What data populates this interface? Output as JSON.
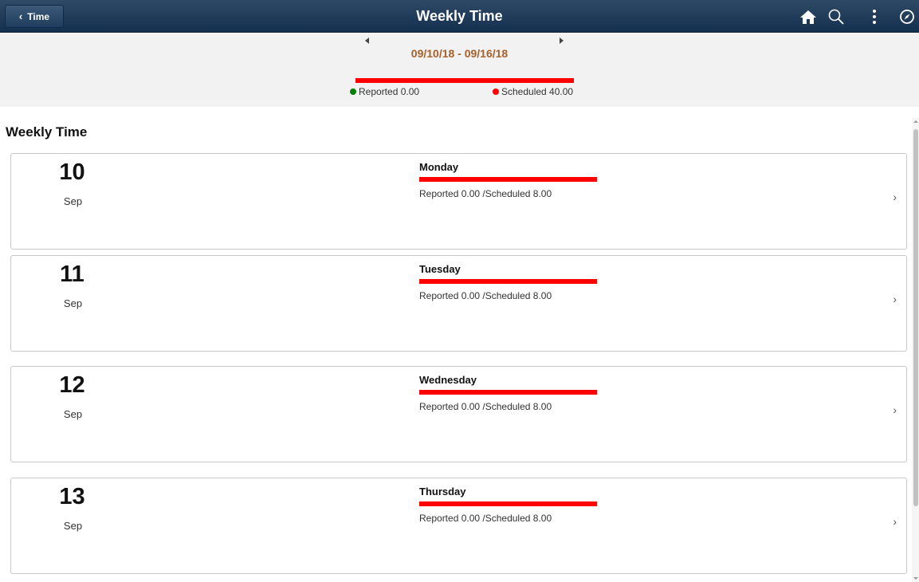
{
  "header": {
    "back_label": "Time",
    "title": "Weekly Time",
    "icons": [
      "home-icon",
      "search-icon",
      "more-vert-icon",
      "navbar-icon"
    ]
  },
  "week": {
    "date_range": "09/10/18 - 09/16/18",
    "reported": "Reported 0.00",
    "scheduled": "Scheduled 40.00",
    "reported_fraction": 0.0
  },
  "section_title": "Weekly Time",
  "days": [
    {
      "day": "10",
      "month": "Sep",
      "weekday": "Monday",
      "hours": "Reported 0.00 /Scheduled 8.00"
    },
    {
      "day": "11",
      "month": "Sep",
      "weekday": "Tuesday",
      "hours": "Reported 0.00 /Scheduled 8.00"
    },
    {
      "day": "12",
      "month": "Sep",
      "weekday": "Wednesday",
      "hours": "Reported 0.00 /Scheduled 8.00"
    },
    {
      "day": "13",
      "month": "Sep",
      "weekday": "Thursday",
      "hours": "Reported 0.00 /Scheduled 8.00"
    }
  ],
  "colors": {
    "header_bg": "#1f3d5e",
    "date_range": "#a8602a",
    "scheduled": "#ff0000",
    "reported": "#008000"
  }
}
